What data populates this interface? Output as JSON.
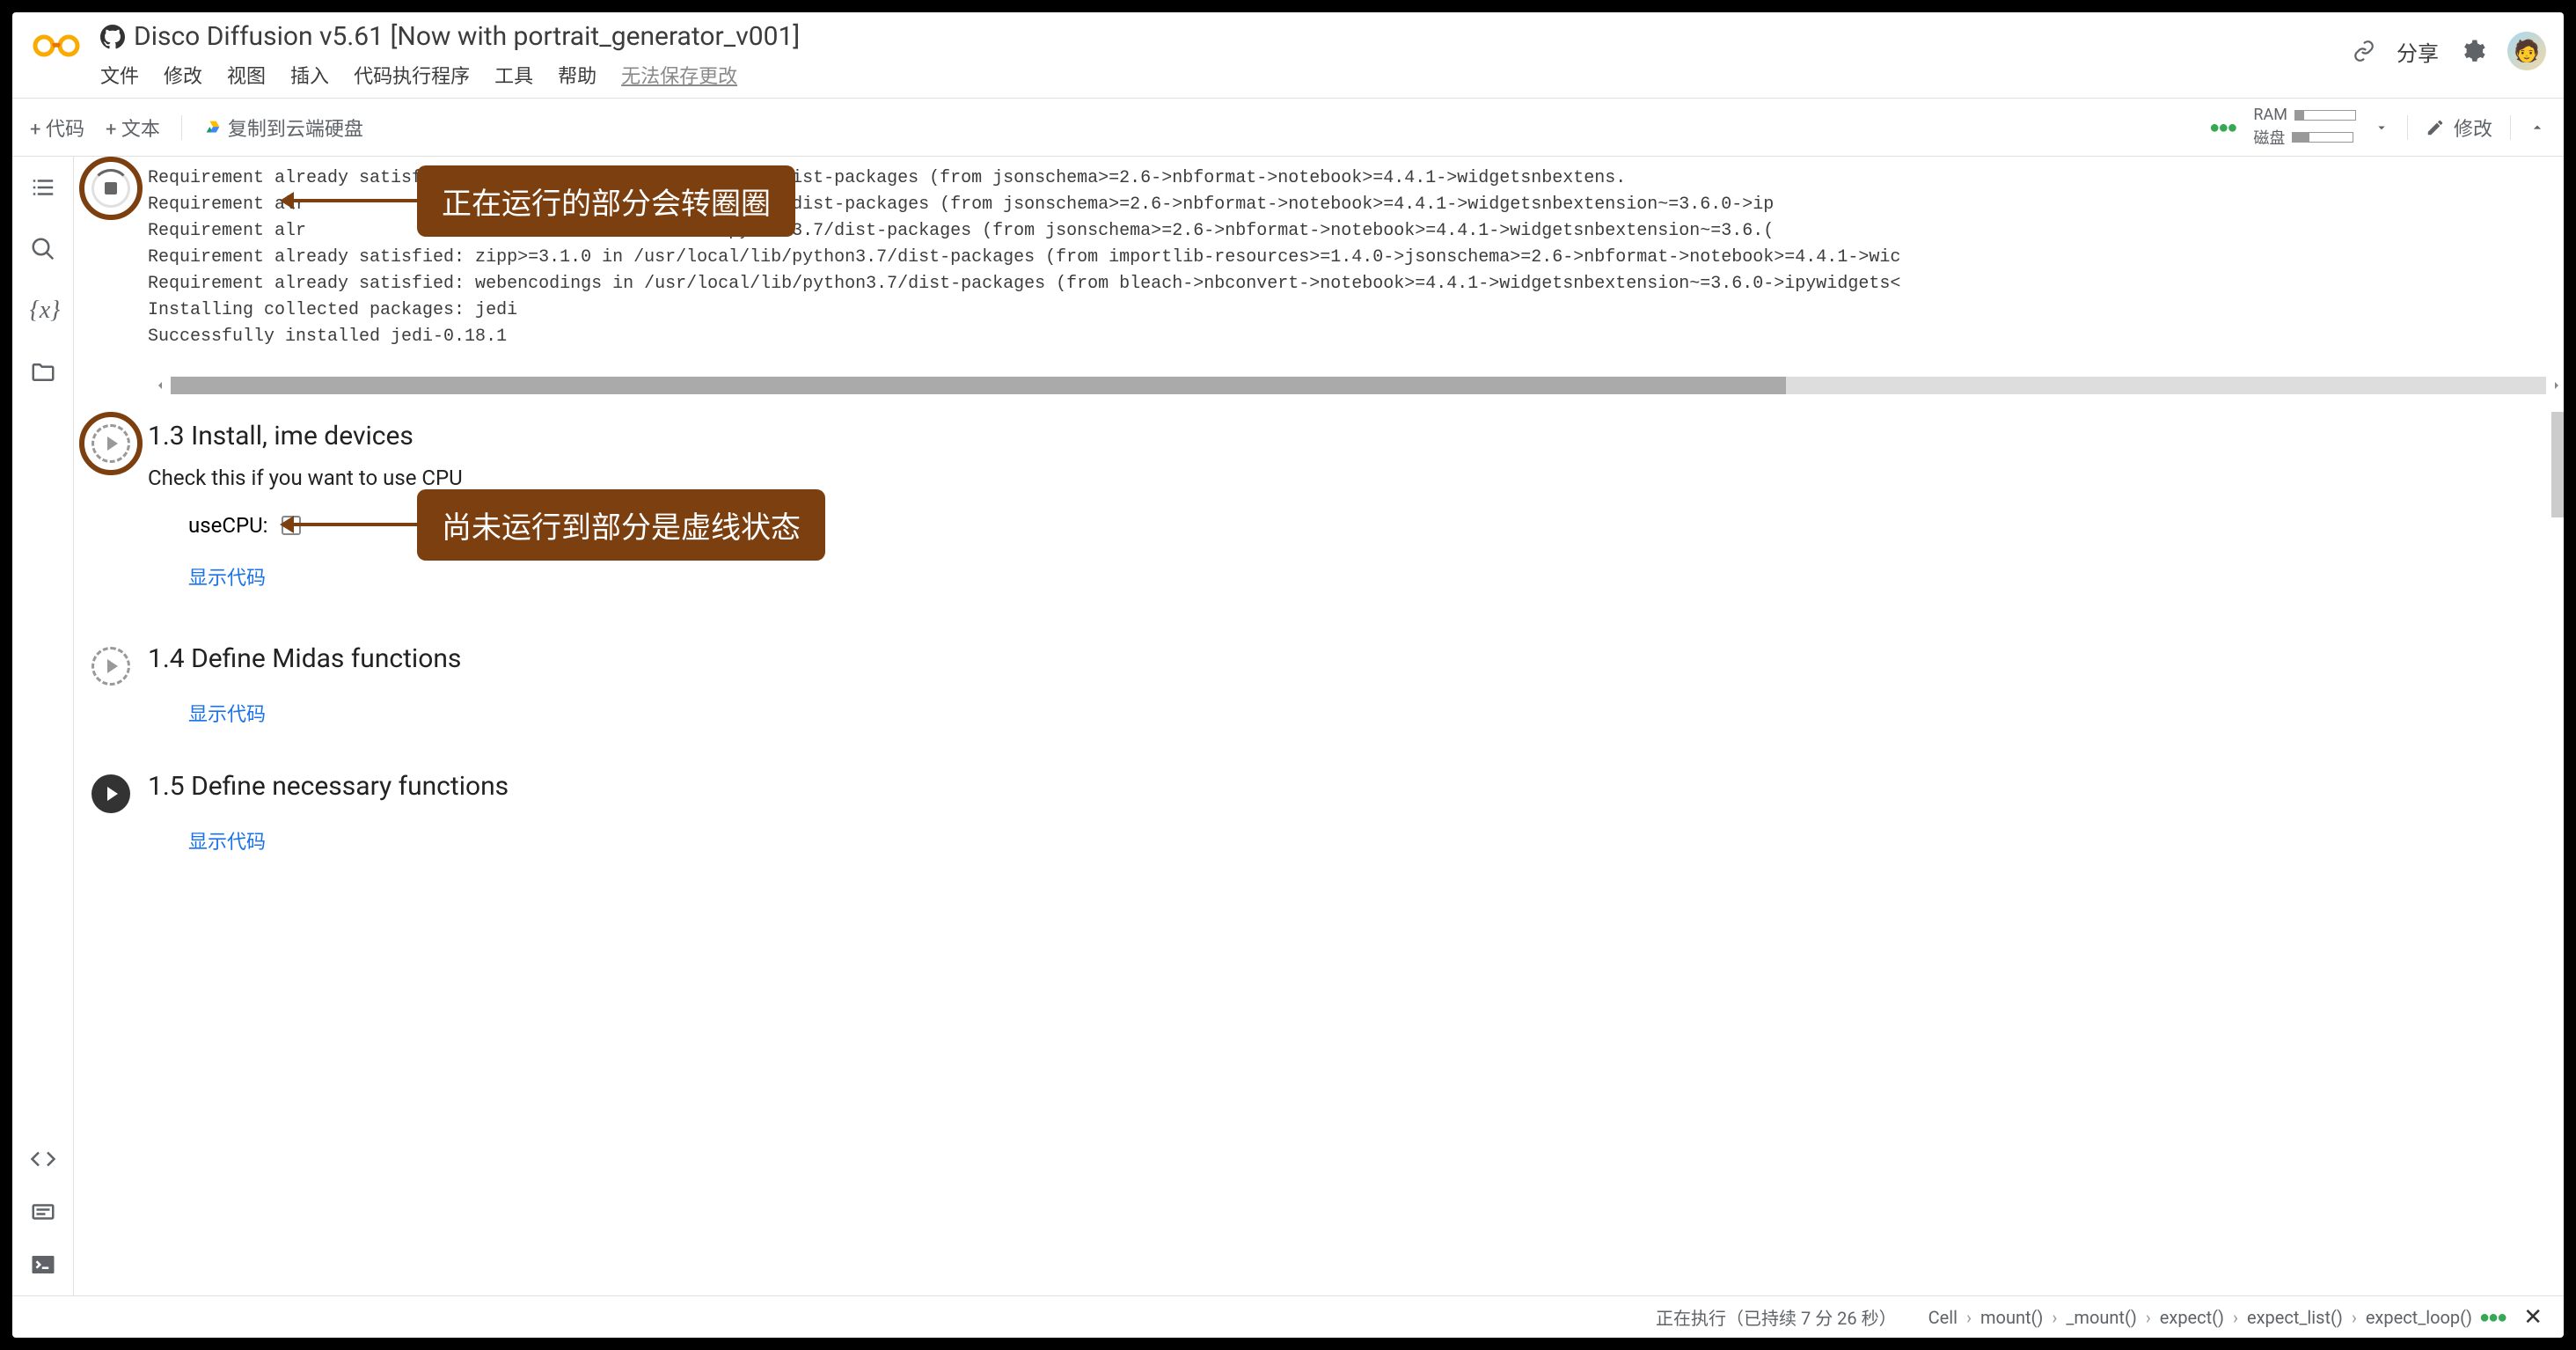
{
  "header": {
    "title": "Disco Diffusion v5.61 [Now with portrait_generator_v001]",
    "menu": [
      "文件",
      "修改",
      "视图",
      "插入",
      "代码执行程序",
      "工具",
      "帮助"
    ],
    "disabled_menu": "无法保存更改",
    "share": "分享"
  },
  "toolbar": {
    "code": "+ 代码",
    "text": "+ 文本",
    "copy_drive": "复制到云端硬盘",
    "ram_label": "RAM",
    "disk_label": "磁盘",
    "edit": "修改"
  },
  "sidebar": {
    "items": [
      "toc",
      "search",
      "variables",
      "files"
    ],
    "bottom": [
      "code-snippets",
      "command-palette",
      "terminal"
    ]
  },
  "annotations": {
    "running": "正在运行的部分会转圈圈",
    "pending": "尚未运行到部分是虚线状态"
  },
  "output_lines": [
    "Requirement already satisfied: ... /usr/local/lib/python3.7/dist-packages (from jsonschema>=2.6->nbformat->notebook>=4.4.1->widgetsnbextens.",
    "Requirement alr                                  b/python3.7/dist-packages (from jsonschema>=2.6->nbformat->notebook>=4.4.1->widgetsnbextension~=3.6.0->ip",
    "Requirement alr                                  l/lib/python3.7/dist-packages (from jsonschema>=2.6->nbformat->notebook>=4.4.1->widgetsnbextension~=3.6.(",
    "Requirement already satisfied: zipp>=3.1.0 in /usr/local/lib/python3.7/dist-packages (from importlib-resources>=1.4.0->jsonschema>=2.6->nbformat->notebook>=4.4.1->wic",
    "Requirement already satisfied: webencodings in /usr/local/lib/python3.7/dist-packages (from bleach->nbconvert->notebook>=4.4.1->widgetsnbextension~=3.6.0->ipywidgets<",
    "Installing collected packages: jedi",
    "Successfully installed jedi-0.18.1"
  ],
  "cells": {
    "c13": {
      "title": "1.3 Install,                              ime devices",
      "subtitle": "Check this if you want to use CPU",
      "form_label": "useCPU:",
      "show_code": "显示代码"
    },
    "c14": {
      "title": "1.4 Define Midas functions",
      "show_code": "显示代码"
    },
    "c15": {
      "title": "1.5 Define necessary functions",
      "show_code": "显示代码"
    }
  },
  "footer": {
    "status": "正在执行（已持续 7 分 26 秒）",
    "path": [
      "Cell",
      "mount()",
      "_mount()",
      "expect()",
      "expect_list()",
      "expect_loop()"
    ]
  }
}
